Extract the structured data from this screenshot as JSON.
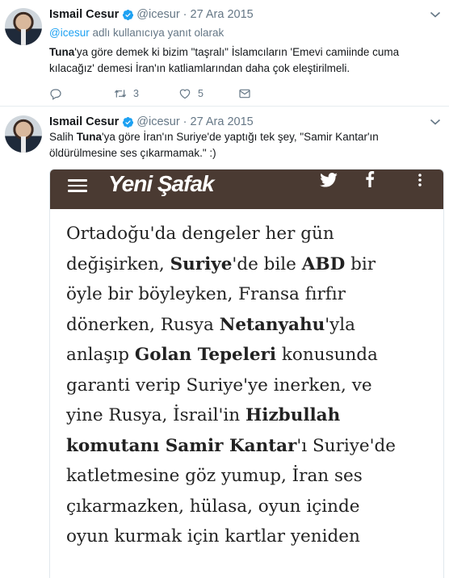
{
  "tweets": [
    {
      "author_name": "Ismail Cesur",
      "handle": "@icesur",
      "separator": "·",
      "date": "27 Ara 2015",
      "reply_prefix_mention": "@icesur",
      "reply_suffix": " adlı kullanıcıya yanıt olarak",
      "text_parts": [
        {
          "bold": "Tuna"
        },
        {
          "plain": "'ya göre demek ki bizim \"taşralı\" İslamcıların 'Emevi camiinde cuma kılacağız' demesi İran'ın katliamlarından daha çok eleştirilmeli."
        }
      ],
      "actions": {
        "reply_count": "",
        "retweet_count": "3",
        "like_count": "5"
      }
    },
    {
      "author_name": "Ismail Cesur",
      "handle": "@icesur",
      "separator": "·",
      "date": "27 Ara 2015",
      "text_parts": [
        {
          "plain": "Salih "
        },
        {
          "bold": "Tuna"
        },
        {
          "plain": "'ya göre İran'ın Suriye'de yaptığı tek şey, \"Samir Kantar'ın öldürülmesine ses çıkarmamak.\" :)"
        }
      ],
      "media": {
        "brand": "Yeni Şafak",
        "article_lines": [
          [
            {
              "plain": "Ortadoğu'da dengeler her gün"
            }
          ],
          [
            {
              "plain": "değişirken, "
            },
            {
              "bold": "Suriye"
            },
            {
              "plain": "'de bile "
            },
            {
              "bold": "ABD"
            },
            {
              "plain": " bir"
            }
          ],
          [
            {
              "plain": "öyle bir böyleyken, Fransa fırfır"
            }
          ],
          [
            {
              "plain": "dönerken, Rusya "
            },
            {
              "bold": "Netanyahu"
            },
            {
              "plain": "'yla"
            }
          ],
          [
            {
              "plain": "anlaşıp "
            },
            {
              "bold": "Golan Tepeleri"
            },
            {
              "plain": " konusunda"
            }
          ],
          [
            {
              "plain": "garanti verip Suriye'ye inerken, ve"
            }
          ],
          [
            {
              "plain": "yine Rusya, İsrail'in "
            },
            {
              "bold": "Hizbullah"
            }
          ],
          [
            {
              "bold": "komutanı Samir Kantar"
            },
            {
              "plain": "'ı Suriye'de"
            }
          ],
          [
            {
              "plain": "katletmesine göz yumup, İran ses"
            }
          ],
          [
            {
              "plain": "çıkarmazken, hülasa, oyun içinde"
            }
          ],
          [
            {
              "plain": "oyun kurmak için kartlar yeniden"
            }
          ]
        ]
      }
    }
  ],
  "icons": {
    "verified": "verified-badge-icon",
    "chevron": "chevron-down-icon",
    "reply": "reply-icon",
    "retweet": "retweet-icon",
    "like": "heart-icon",
    "dm": "envelope-icon",
    "menu": "hamburger-menu-icon",
    "twitter": "twitter-bird-icon",
    "facebook": "facebook-icon",
    "more": "more-vertical-icon"
  },
  "colors": {
    "link": "#1da1f2",
    "secondary_text": "#657786",
    "primary_text": "#14171a",
    "media_header": "#4a3a32"
  }
}
